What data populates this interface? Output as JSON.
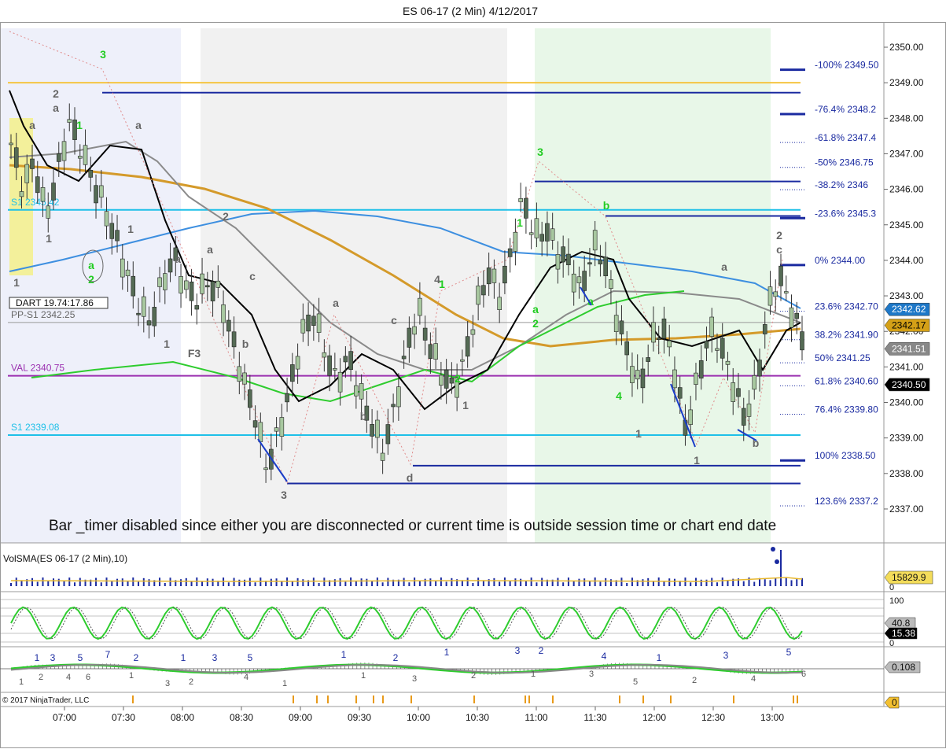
{
  "chart_data": {
    "type": "candlestick",
    "title": "ES 06-17 (2 Min)  4/12/2017",
    "price_ticks": [
      "2350.00",
      "2349.00",
      "2348.00",
      "2347.00",
      "2346.00",
      "2345.00",
      "2344.00",
      "2343.00",
      "2342.00",
      "2341.00",
      "2340.00",
      "2339.00",
      "2338.00",
      "2337.00"
    ],
    "time_ticks": [
      "07:00",
      "07:30",
      "08:00",
      "08:30",
      "09:00",
      "09:30",
      "10:00",
      "10:30",
      "11:00",
      "11:30",
      "12:00",
      "12:30",
      "13:00"
    ],
    "ylim": [
      2336.7,
      2350.3
    ],
    "price_markers": [
      {
        "text": "2342.62",
        "value": 2342.62,
        "bg": "#1e78c8",
        "fg": "#ffffff"
      },
      {
        "text": "2342.17",
        "value": 2342.17,
        "bg": "#d4a017",
        "fg": "#000000"
      },
      {
        "text": "2341.51",
        "value": 2341.51,
        "bg": "#888888",
        "fg": "#ffffff"
      },
      {
        "text": "2340.50",
        "value": 2340.5,
        "bg": "#000000",
        "fg": "#ffffff"
      }
    ],
    "level_lines": [
      {
        "value": 2349.0,
        "color": "#f5c542",
        "label": ""
      },
      {
        "value": 2348.72,
        "color": "#1a2aa0",
        "label": ""
      },
      {
        "value": 2346.22,
        "color": "#1a2aa0",
        "label": ""
      },
      {
        "value": 2345.42,
        "color": "#1ec0e8",
        "label": "S1 2345.42"
      },
      {
        "value": 2345.25,
        "color": "#1a2aa0",
        "label": ""
      },
      {
        "value": 2342.25,
        "color": "#999999",
        "label": "PP-S1 2342.25"
      },
      {
        "value": 2340.75,
        "color": "#9b30b0",
        "label": "VAL 2340.75"
      },
      {
        "value": 2339.08,
        "color": "#1ec0e8",
        "label": "S1 2339.08"
      },
      {
        "value": 2338.22,
        "color": "#1a2aa0",
        "label": ""
      },
      {
        "value": 2337.72,
        "color": "#1a2aa0",
        "label": ""
      }
    ],
    "fib_levels": [
      {
        "pct": "-100%",
        "price": "2349.50",
        "value": 2349.5
      },
      {
        "pct": "-76.4%",
        "price": "2348.2",
        "value": 2348.25
      },
      {
        "pct": "-61.8%",
        "price": "2347.4",
        "value": 2347.45
      },
      {
        "pct": "-50%",
        "price": "2346.75",
        "value": 2346.75
      },
      {
        "pct": "-38.2%",
        "price": "2346",
        "value": 2346.12
      },
      {
        "pct": "-23.6%",
        "price": "2345.3",
        "value": 2345.32
      },
      {
        "pct": "0%",
        "price": "2344.00",
        "value": 2344.0
      },
      {
        "pct": "23.6%",
        "price": "2342.70",
        "value": 2342.7
      },
      {
        "pct": "38.2%",
        "price": "2341.90",
        "value": 2341.9
      },
      {
        "pct": "50%",
        "price": "2341.25",
        "value": 2341.25
      },
      {
        "pct": "61.8%",
        "price": "2340.60",
        "value": 2340.6
      },
      {
        "pct": "76.4%",
        "price": "2339.80",
        "value": 2339.8
      },
      {
        "pct": "100%",
        "price": "2338.50",
        "value": 2338.5
      },
      {
        "pct": "123.6%",
        "price": "2337.2",
        "value": 2337.22
      }
    ],
    "dart_label": "DART 19.74:17.86",
    "notice": "Bar _timer disabled since either you are disconnected or current time is outside session time or chart end date",
    "wave_labels": [
      {
        "t": "3",
        "x": 131,
        "y": 74,
        "c": "#22cc22"
      },
      {
        "t": "2",
        "x": 71,
        "y": 124,
        "c": "#666666"
      },
      {
        "t": "a",
        "x": 71,
        "y": 142,
        "c": "#666666"
      },
      {
        "t": "a",
        "x": 41,
        "y": 164,
        "c": "#666666"
      },
      {
        "t": "1",
        "x": 101,
        "y": 164,
        "c": "#22cc22"
      },
      {
        "t": "a",
        "x": 176,
        "y": 164,
        "c": "#666666"
      },
      {
        "t": "1",
        "x": 62,
        "y": 308,
        "c": "#666666"
      },
      {
        "t": "1",
        "x": 166,
        "y": 296,
        "c": "#666666"
      },
      {
        "t": "a",
        "x": 116,
        "y": 342,
        "c": "#22cc22"
      },
      {
        "t": "2",
        "x": 116,
        "y": 360,
        "c": "#22cc22"
      },
      {
        "t": "1",
        "x": 21,
        "y": 364,
        "c": "#666666"
      },
      {
        "t": "2",
        "x": 287,
        "y": 280,
        "c": "#666666"
      },
      {
        "t": "a",
        "x": 267,
        "y": 322,
        "c": "#666666"
      },
      {
        "t": "a",
        "x": 226,
        "y": 334,
        "c": "#666666"
      },
      {
        "t": "c",
        "x": 321,
        "y": 356,
        "c": "#666666"
      },
      {
        "t": "1",
        "x": 212,
        "y": 442,
        "c": "#666666"
      },
      {
        "t": "F3",
        "x": 247,
        "y": 454,
        "c": "#666666"
      },
      {
        "t": "b",
        "x": 312,
        "y": 442,
        "c": "#666666"
      },
      {
        "t": "a",
        "x": 427,
        "y": 390,
        "c": "#666666"
      },
      {
        "t": "c",
        "x": 501,
        "y": 412,
        "c": "#666666"
      },
      {
        "t": "b",
        "x": 462,
        "y": 534,
        "c": "#666666"
      },
      {
        "t": "4",
        "x": 556,
        "y": 360,
        "c": "#666666"
      },
      {
        "t": "1",
        "x": 562,
        "y": 366,
        "c": "#22cc22"
      },
      {
        "t": "2",
        "x": 582,
        "y": 486,
        "c": "#22cc22"
      },
      {
        "t": "1",
        "x": 592,
        "y": 520,
        "c": "#666666"
      },
      {
        "t": "3",
        "x": 361,
        "y": 634,
        "c": "#666666"
      },
      {
        "t": "d",
        "x": 521,
        "y": 612,
        "c": "#666666"
      },
      {
        "t": "3",
        "x": 687,
        "y": 198,
        "c": "#22cc22"
      },
      {
        "t": "1",
        "x": 661,
        "y": 288,
        "c": "#22cc22"
      },
      {
        "t": "a",
        "x": 681,
        "y": 398,
        "c": "#22cc22"
      },
      {
        "t": "2",
        "x": 681,
        "y": 416,
        "c": "#22cc22"
      },
      {
        "t": "b",
        "x": 771,
        "y": 266,
        "c": "#22cc22"
      },
      {
        "t": "a",
        "x": 751,
        "y": 388,
        "c": "#22cc22"
      },
      {
        "t": "4",
        "x": 787,
        "y": 508,
        "c": "#22cc22"
      },
      {
        "t": "1",
        "x": 812,
        "y": 556,
        "c": "#666666"
      },
      {
        "t": "1",
        "x": 886,
        "y": 590,
        "c": "#666666"
      },
      {
        "t": "a",
        "x": 921,
        "y": 344,
        "c": "#666666"
      },
      {
        "t": "b",
        "x": 961,
        "y": 568,
        "c": "#666666"
      },
      {
        "t": "2",
        "x": 991,
        "y": 304,
        "c": "#666666"
      },
      {
        "t": "c",
        "x": 991,
        "y": 322,
        "c": "#666666"
      }
    ],
    "volume_indicator": {
      "label": "VolSMA(ES 06-17 (2 Min),10)",
      "marker": "15829.9",
      "zero": "0"
    },
    "stochastic": {
      "marker_top": "40.8",
      "marker_bottom": "15.38",
      "tick_high": "100",
      "tick_low": "0"
    },
    "macd": {
      "marker": "0.108"
    },
    "macd_labels": [
      {
        "t": "1",
        "x": 47,
        "y": 840
      },
      {
        "t": "3",
        "x": 67,
        "y": 840
      },
      {
        "t": "5",
        "x": 102,
        "y": 840
      },
      {
        "t": "7",
        "x": 137,
        "y": 836
      },
      {
        "t": "2",
        "x": 173,
        "y": 840
      },
      {
        "t": "1",
        "x": 233,
        "y": 840
      },
      {
        "t": "3",
        "x": 273,
        "y": 840
      },
      {
        "t": "5",
        "x": 318,
        "y": 840
      },
      {
        "t": "1",
        "x": 437,
        "y": 836
      },
      {
        "t": "2",
        "x": 503,
        "y": 840
      },
      {
        "t": "1",
        "x": 568,
        "y": 833
      },
      {
        "t": "3",
        "x": 658,
        "y": 831
      },
      {
        "t": "2",
        "x": 688,
        "y": 831
      },
      {
        "t": "4",
        "x": 768,
        "y": 838
      },
      {
        "t": "1",
        "x": 838,
        "y": 840
      },
      {
        "t": "3",
        "x": 923,
        "y": 837
      },
      {
        "t": "5",
        "x": 1003,
        "y": 833
      },
      {
        "t": "1",
        "x": 27,
        "y": 870
      },
      {
        "t": "2",
        "x": 52,
        "y": 864
      },
      {
        "t": "4",
        "x": 87,
        "y": 864
      },
      {
        "t": "6",
        "x": 112,
        "y": 864
      },
      {
        "t": "1",
        "x": 167,
        "y": 862
      },
      {
        "t": "3",
        "x": 213,
        "y": 872
      },
      {
        "t": "2",
        "x": 243,
        "y": 870
      },
      {
        "t": "4",
        "x": 313,
        "y": 864
      },
      {
        "t": "1",
        "x": 362,
        "y": 872
      },
      {
        "t": "1",
        "x": 462,
        "y": 862
      },
      {
        "t": "3",
        "x": 527,
        "y": 866
      },
      {
        "t": "2",
        "x": 602,
        "y": 862
      },
      {
        "t": "1",
        "x": 678,
        "y": 860
      },
      {
        "t": "3",
        "x": 752,
        "y": 860
      },
      {
        "t": "5",
        "x": 808,
        "y": 870
      },
      {
        "t": "2",
        "x": 883,
        "y": 868
      },
      {
        "t": "4",
        "x": 958,
        "y": 866
      },
      {
        "t": "6",
        "x": 1022,
        "y": 860
      }
    ],
    "copyright": "© 2017 NinjaTrader, LLC",
    "trade_panel_marker": "0"
  }
}
